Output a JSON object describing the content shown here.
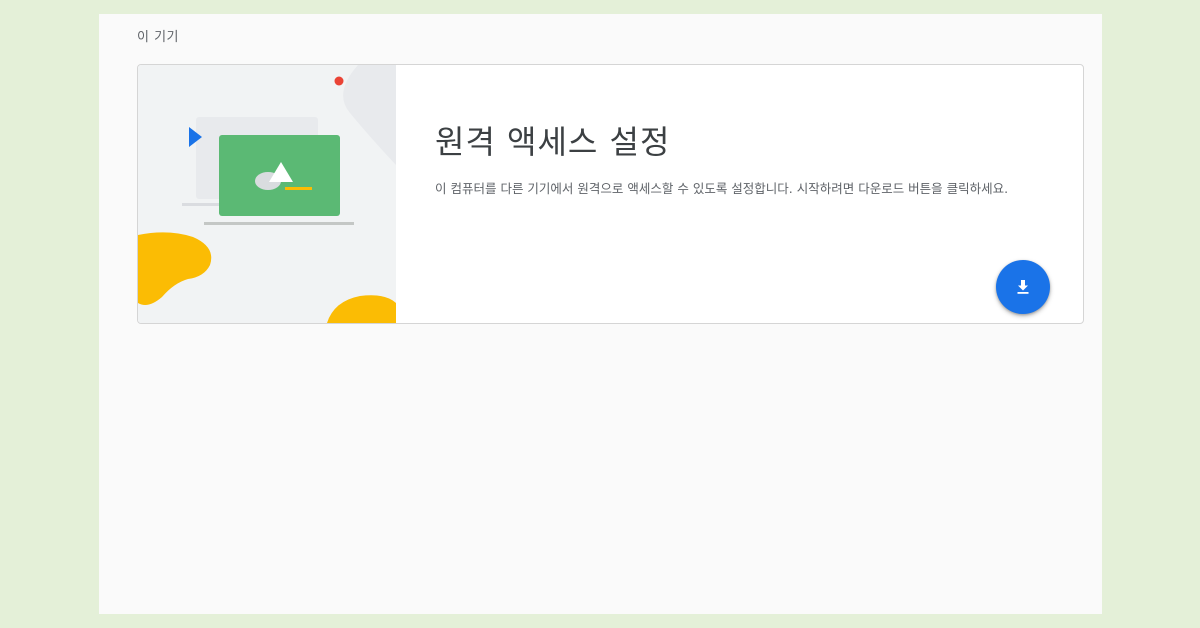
{
  "section": {
    "heading": "이 기기"
  },
  "card": {
    "title": "원격 액세스 설정",
    "description": "이 컴퓨터를 다른 기기에서 원격으로 액세스할 수 있도록 설정합니다. 시작하려면 다운로드 버튼을 클릭하세요.",
    "download_icon": "download-icon"
  },
  "colors": {
    "page_bg": "#e4f0d8",
    "panel_bg": "#fafafa",
    "accent_blue": "#1a73e8",
    "illustration_green": "#5bb974",
    "illustration_yellow": "#fbbc04",
    "illustration_red": "#ea4335"
  }
}
